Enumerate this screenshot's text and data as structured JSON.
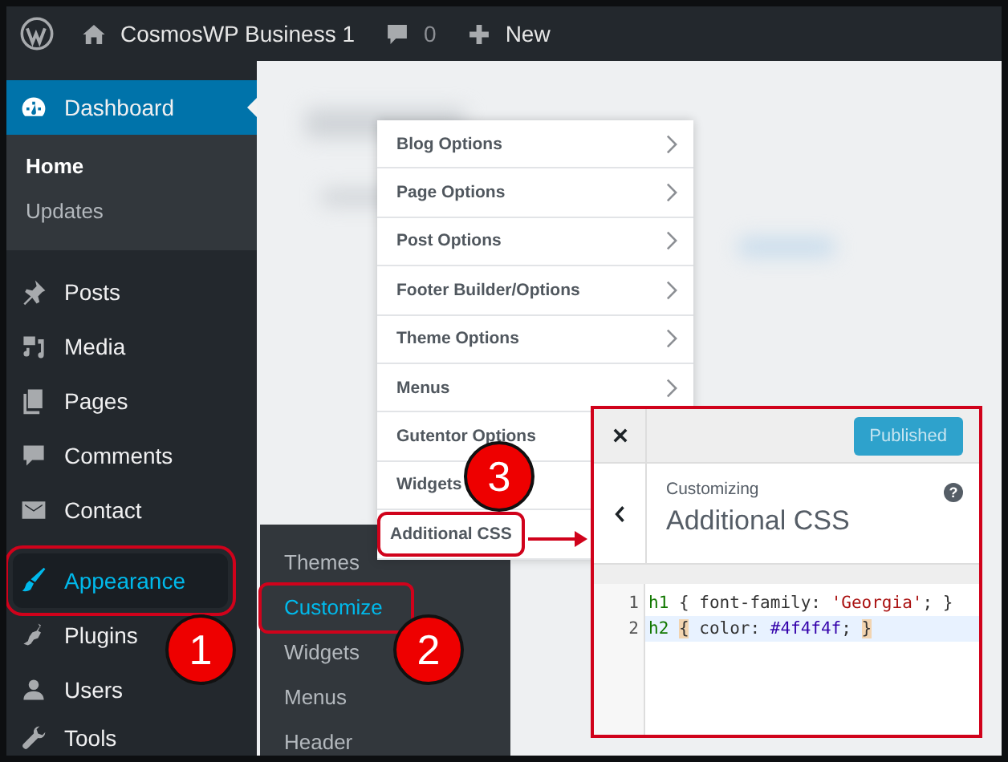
{
  "admin_bar": {
    "site_name": "CosmosWP Business 1",
    "comment_count": "0",
    "new_label": "New"
  },
  "sidebar": {
    "items": [
      {
        "label": "Dashboard",
        "selected": true,
        "hovered": false,
        "marked": false,
        "children": [
          {
            "label": "Home",
            "selected": true
          },
          {
            "label": "Updates",
            "selected": false
          }
        ]
      },
      {
        "label": "Posts",
        "selected": false,
        "hovered": false,
        "marked": false
      },
      {
        "label": "Media",
        "selected": false,
        "hovered": false,
        "marked": false
      },
      {
        "label": "Pages",
        "selected": false,
        "hovered": false,
        "marked": false
      },
      {
        "label": "Comments",
        "selected": false,
        "hovered": false,
        "marked": false
      },
      {
        "label": "Contact",
        "selected": false,
        "hovered": false,
        "marked": false
      },
      {
        "label": "Appearance",
        "selected": false,
        "hovered": true,
        "marked": true
      },
      {
        "label": "Plugins",
        "selected": false,
        "hovered": false,
        "marked": false
      },
      {
        "label": "Users",
        "selected": false,
        "hovered": false,
        "marked": false
      },
      {
        "label": "Tools",
        "selected": false,
        "hovered": false,
        "marked": false
      }
    ]
  },
  "appearance_submenu": {
    "items": [
      {
        "label": "Themes",
        "selected": false,
        "marked": false
      },
      {
        "label": "Customize",
        "selected": true,
        "marked": true
      },
      {
        "label": "Widgets",
        "selected": false,
        "marked": false
      },
      {
        "label": "Menus",
        "selected": false,
        "marked": false
      },
      {
        "label": "Header",
        "selected": false,
        "marked": false
      }
    ]
  },
  "customizer_menu": {
    "items": [
      {
        "label": "Blog Options",
        "has_arrow": true,
        "marked": false
      },
      {
        "label": "Page Options",
        "has_arrow": true,
        "marked": false
      },
      {
        "label": "Post Options",
        "has_arrow": true,
        "marked": false
      },
      {
        "label": "Footer Builder/Options",
        "has_arrow": true,
        "marked": false
      },
      {
        "label": "Theme Options",
        "has_arrow": true,
        "marked": false
      },
      {
        "label": "Menus",
        "has_arrow": true,
        "marked": false
      },
      {
        "label": "Gutentor Options",
        "marked": false
      },
      {
        "label": "Widgets",
        "marked": false
      },
      {
        "label": "Additional CSS",
        "marked": true
      }
    ]
  },
  "css_panel": {
    "publish_button": "Published",
    "breadcrumb": "Customizing",
    "title": "Additional CSS",
    "help": "?",
    "code_lines": [
      {
        "number": "1",
        "selected": false,
        "tokens": [
          {
            "kind": "tag",
            "text": "h1"
          },
          {
            "kind": "plain",
            "text": " { font-family: "
          },
          {
            "kind": "string",
            "text": "'Georgia'"
          },
          {
            "kind": "plain",
            "text": "; }"
          }
        ]
      },
      {
        "number": "2",
        "selected": true,
        "tokens": [
          {
            "kind": "tag",
            "text": "h2 "
          },
          {
            "kind": "bracket",
            "text": "{"
          },
          {
            "kind": "plain",
            "text": " color: "
          },
          {
            "kind": "color",
            "text": "#4f4f4f"
          },
          {
            "kind": "plain",
            "text": "; "
          },
          {
            "kind": "bracket",
            "text": "}"
          }
        ]
      }
    ]
  },
  "callouts": [
    {
      "number": "1"
    },
    {
      "number": "2"
    },
    {
      "number": "3"
    }
  ]
}
